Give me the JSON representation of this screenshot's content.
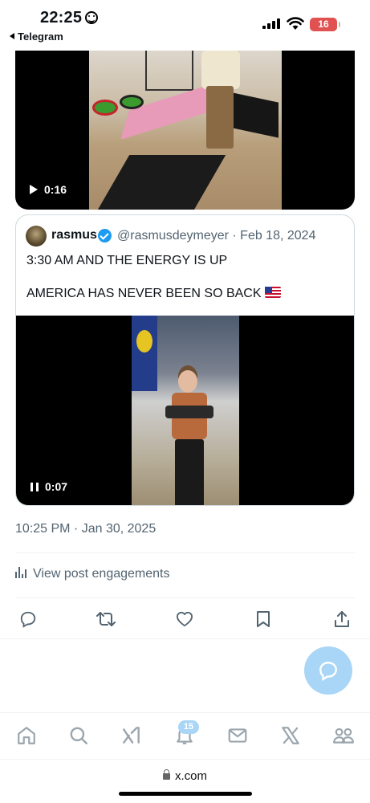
{
  "status_bar": {
    "time": "22:25",
    "back_app": "Telegram",
    "battery": "16"
  },
  "video1": {
    "duration": "0:16",
    "state_icon": "play-icon"
  },
  "quoted_post": {
    "author_name": "rasmus",
    "author_handle_date": "@rasmusdeymeyer · Feb 18, 2024",
    "text_line1": "3:30 AM AND THE ENERGY IS UP",
    "text_line2": "AMERICA HAS NEVER BEEN SO BACK",
    "flag_icon": "us-flag-icon",
    "video": {
      "duration": "0:07",
      "state_icon": "pause-icon"
    }
  },
  "post_meta": {
    "timestamp": "10:25 PM · Jan 30, 2025",
    "engagements_label": "View post engagements"
  },
  "actions": [
    "reply-icon",
    "repost-icon",
    "like-icon",
    "bookmark-icon",
    "share-icon"
  ],
  "bottom_nav": {
    "items": [
      "home-icon",
      "search-icon",
      "grok-icon",
      "notifications-icon",
      "messages-icon",
      "x-premium-icon",
      "communities-icon"
    ],
    "notifications_badge": "15"
  },
  "browser": {
    "url": "x.com"
  },
  "colors": {
    "accent": "#1d9bf0",
    "fab": "#a9d6f7",
    "secondary_text": "#536471",
    "battery": "#e05252"
  }
}
